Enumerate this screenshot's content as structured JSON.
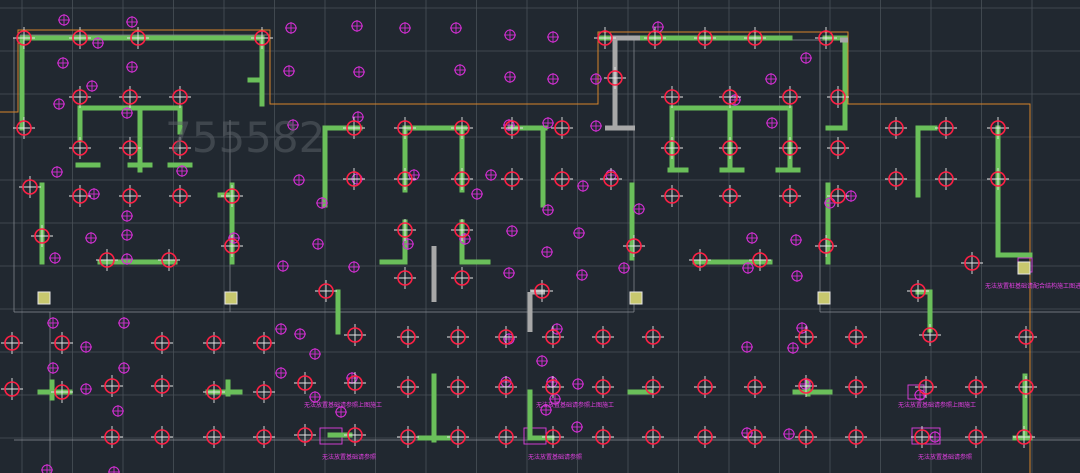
{
  "viewport": {
    "type": "cad-drawing",
    "background_color": "#212830",
    "grid_color": "#4a5058",
    "wall_color": "#6abf5a",
    "gray_wall_color": "#a8a8a8",
    "pile_marker_color": "#ff2045",
    "crosshair_color": "#e6e6e6",
    "small_marker_color": "#d22fd2",
    "boundary_line_color": "#d7852a",
    "annotation_color": "#e040e0",
    "marker_square_fill": "#c8c86e"
  },
  "watermark": {
    "text": "755582"
  },
  "annotations": {
    "right_note": "无法放置桩基础请配合结构施工图进行施工布置",
    "left_note_1": "无法放置基础请参照上图施工",
    "left_note_2": "无法放置基础请参照",
    "mid_note_1": "无法放置基础请参照上图施工",
    "mid_note_2": "无法放置基础请参照",
    "right_note_2": "无法放置基础请参照上图施工",
    "right_note_3": "无法放置基础请参照"
  }
}
